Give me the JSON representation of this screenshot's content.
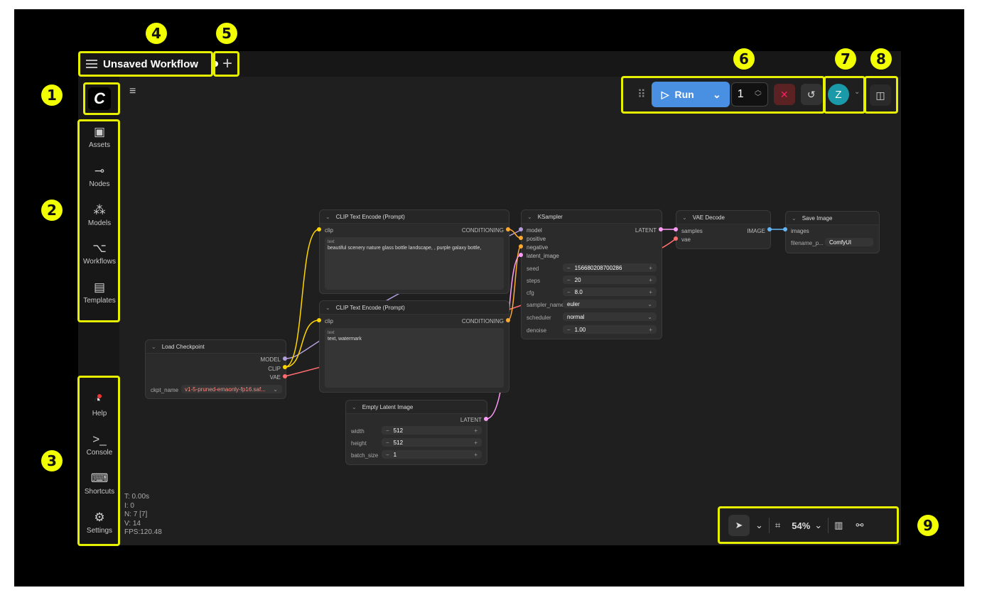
{
  "tabs": {
    "active_title": "Unsaved Workflow",
    "add_label": "+"
  },
  "sidebar": {
    "logo_letter": "C",
    "top_items": [
      {
        "label": "Assets",
        "icon": "image-icon"
      },
      {
        "label": "Nodes",
        "icon": "plug-icon"
      },
      {
        "label": "Models",
        "icon": "models-icon"
      },
      {
        "label": "Workflows",
        "icon": "workflow-icon"
      },
      {
        "label": "Templates",
        "icon": "templates-icon"
      }
    ],
    "bottom_items": [
      {
        "label": "Help",
        "icon": "help-icon"
      },
      {
        "label": "Console",
        "icon": "terminal-icon"
      },
      {
        "label": "Shortcuts",
        "icon": "keyboard-icon"
      },
      {
        "label": "Settings",
        "icon": "gear-icon"
      }
    ]
  },
  "toolbar": {
    "run_label": "Run",
    "batch_count": "1"
  },
  "user": {
    "avatar_letter": "Z"
  },
  "annotations": [
    "1",
    "2",
    "3",
    "4",
    "5",
    "6",
    "7",
    "8",
    "9"
  ],
  "nodes": {
    "clip1": {
      "title": "CLIP Text Encode (Prompt)",
      "input": "clip",
      "output": "CONDITIONING",
      "text_label": "text",
      "text": "beautiful scenery nature glass bottle landscape, , purple galaxy bottle,"
    },
    "clip2": {
      "title": "CLIP Text Encode (Prompt)",
      "input": "clip",
      "output": "CONDITIONING",
      "text_label": "text",
      "text": "text, watermark"
    },
    "ksampler": {
      "title": "KSampler",
      "inputs": [
        "model",
        "positive",
        "negative",
        "latent_image"
      ],
      "output": "LATENT",
      "widgets": [
        {
          "name": "seed",
          "value": "156680208700286"
        },
        {
          "name": "steps",
          "value": "20"
        },
        {
          "name": "cfg",
          "value": "8.0"
        },
        {
          "name": "sampler_name",
          "value": "euler"
        },
        {
          "name": "scheduler",
          "value": "normal"
        },
        {
          "name": "denoise",
          "value": "1.00"
        }
      ]
    },
    "vae": {
      "title": "VAE Decode",
      "inputs": [
        "samples",
        "vae"
      ],
      "output": "IMAGE"
    },
    "save": {
      "title": "Save Image",
      "input": "images",
      "widget_name": "filename_p...",
      "widget_value": "ComfyUI"
    },
    "checkpoint": {
      "title": "Load Checkpoint",
      "outputs": [
        "MODEL",
        "CLIP",
        "VAE"
      ],
      "widget_name": "ckpt_name",
      "widget_value": "v1-5-pruned-emaonly-fp16.saf..."
    },
    "latent": {
      "title": "Empty Latent Image",
      "output": "LATENT",
      "widgets": [
        {
          "name": "width",
          "value": "512"
        },
        {
          "name": "height",
          "value": "512"
        },
        {
          "name": "batch_size",
          "value": "1"
        }
      ]
    }
  },
  "stats": {
    "t": "T: 0.00s",
    "i": "I: 0",
    "n": "N: 7 [7]",
    "v": "V: 14",
    "fps": "FPS:120.48"
  },
  "bottom": {
    "zoom": "54%"
  },
  "colors": {
    "accent": "#4a90e2",
    "annotation": "#f2ff00",
    "model_wire": "#b39ddb",
    "clip_wire": "#ffd500",
    "vae_wire": "#ff6e6e",
    "cond_wire": "#ffa931",
    "latent_wire": "#ff9cf9",
    "image_wire": "#64b5f6"
  }
}
